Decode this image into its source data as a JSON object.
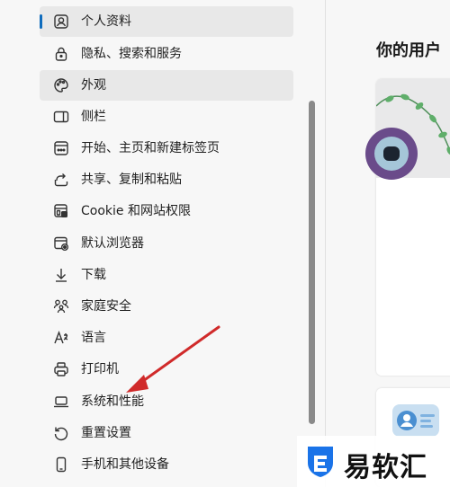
{
  "sidebar": {
    "items": [
      {
        "label": "个人资料",
        "icon": "profile-icon",
        "state": "active"
      },
      {
        "label": "隐私、搜索和服务",
        "icon": "lock-icon"
      },
      {
        "label": "外观",
        "icon": "palette-icon",
        "state": "hovered"
      },
      {
        "label": "侧栏",
        "icon": "sidebar-icon"
      },
      {
        "label": "开始、主页和新建标签页",
        "icon": "home-tab-icon"
      },
      {
        "label": "共享、复制和粘贴",
        "icon": "share-icon"
      },
      {
        "label": "Cookie 和网站权限",
        "icon": "site-permissions-icon"
      },
      {
        "label": "默认浏览器",
        "icon": "browser-icon"
      },
      {
        "label": "下载",
        "icon": "download-icon"
      },
      {
        "label": "家庭安全",
        "icon": "family-icon"
      },
      {
        "label": "语言",
        "icon": "language-icon"
      },
      {
        "label": "打印机",
        "icon": "printer-icon"
      },
      {
        "label": "系统和性能",
        "icon": "laptop-icon"
      },
      {
        "label": "重置设置",
        "icon": "reset-icon"
      },
      {
        "label": "手机和其他设备",
        "icon": "phone-icon"
      }
    ]
  },
  "main": {
    "title": "你的用户"
  },
  "watermark": {
    "text": "易软汇"
  },
  "colors": {
    "accent": "#0f6cbd",
    "arrow": "#d02a2a",
    "avatar": "#6a4b8a"
  }
}
